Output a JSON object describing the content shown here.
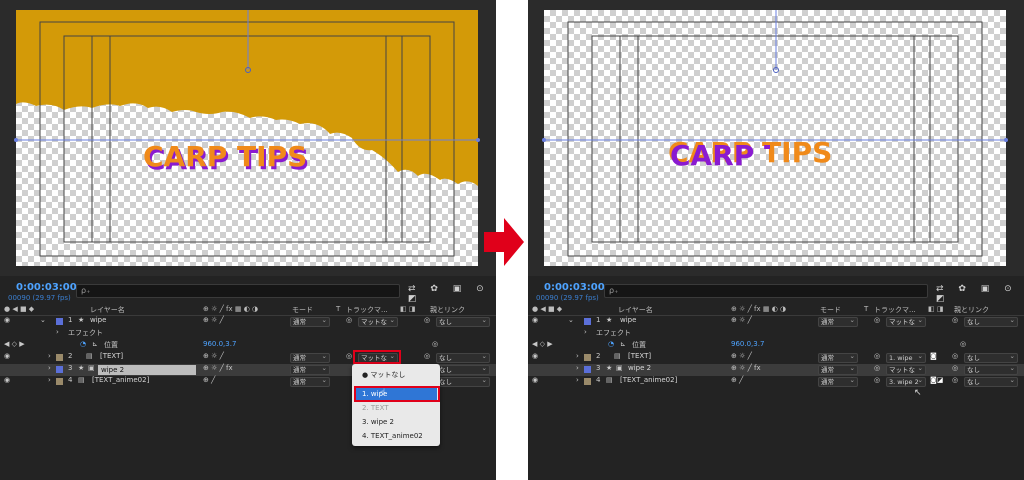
{
  "timeline": {
    "timecode": "0:00:03:00",
    "fps": "00090 (29.97 fps)",
    "search_placeholder": "ρ₊",
    "col_layer_name": "レイヤー名",
    "col_mode": "モード",
    "col_t": "T",
    "col_track_matte_left": "トラックマ...",
    "col_track_matte_right": "トラックマ...",
    "col_parent": "親とリンク",
    "effect_label": "エフェクト",
    "position_label": "位置",
    "position_value": "960.0,3.7"
  },
  "layers": [
    {
      "num": "1",
      "name": "wipe",
      "color": "#5b6fd8",
      "mode": "通常",
      "parent": "なし"
    },
    {
      "num": "2",
      "name": "[TEXT]",
      "color": "#9a8a6a",
      "mode": "通常",
      "parent": "なし"
    },
    {
      "num": "3",
      "name": "wipe 2",
      "color": "#5b6fd8",
      "mode": "通常",
      "parent": "なし"
    },
    {
      "num": "4",
      "name": "[TEXT_anime02]",
      "color": "#9a8a6a",
      "mode": "通常",
      "parent": "なし"
    }
  ],
  "left": {
    "matte_l1": "マットな",
    "matte_l2": "マットな",
    "dropdown_menu": [
      "マットなし",
      "1. wipe",
      "2. TEXT",
      "3. wipe 2",
      "4. TEXT_anime02"
    ]
  },
  "right": {
    "matte_l1": "マットな",
    "matte_l2": "1. wipe",
    "matte_l3": "マットな",
    "matte_l4": "3. wipe 2"
  },
  "comp_text": "CARP TIPS",
  "colors": {
    "accent": "#4ea3ff",
    "wipe_fill": "#d39a08",
    "text_orange": "#f08a1a",
    "text_purple": "#8a1ad0",
    "highlight_red": "#e0001a",
    "menu_highlight": "#2f76d6"
  }
}
